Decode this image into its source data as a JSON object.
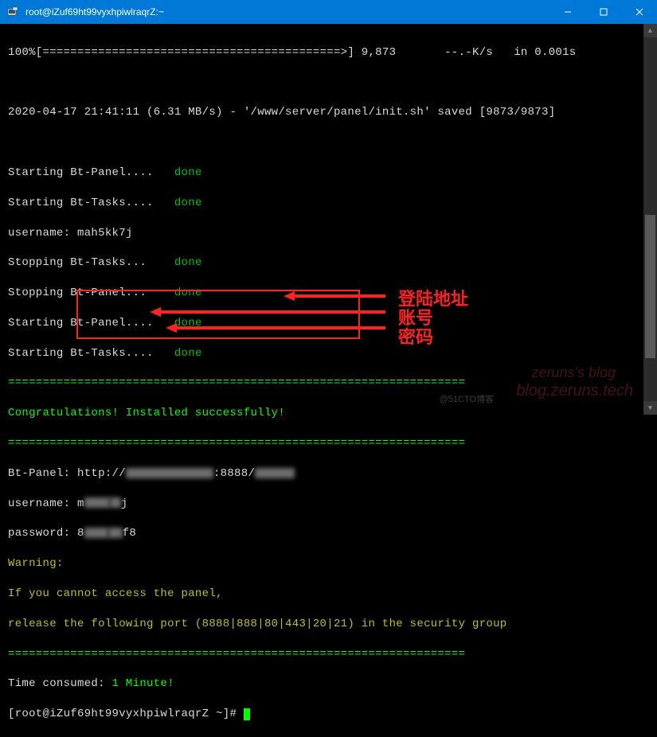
{
  "titlebar": {
    "title": "root@iZuf69ht99vyxhpiwlraqrZ:~"
  },
  "terminal": {
    "progress": "100%[===========================================>] 9,873       --.-K/s   in 0.001s",
    "saved": "2020-04-17 21:41:11 (6.31 MB/s) - '/www/server/panel/init.sh' saved [9873/9873]",
    "services": [
      {
        "label": "Starting Bt-Panel....   ",
        "status": "done"
      },
      {
        "label": "Starting Bt-Tasks....   ",
        "status": "done"
      }
    ],
    "username_line": "username: mah5kk7j",
    "services2": [
      {
        "label": "Stopping Bt-Tasks...    ",
        "status": "done"
      },
      {
        "label": "Stopping Bt-Panel...    ",
        "status": "done"
      },
      {
        "label": "Starting Bt-Panel....   ",
        "status": "done"
      },
      {
        "label": "Starting Bt-Tasks....   ",
        "status": "done"
      }
    ],
    "divider": "==================================================================",
    "congrats": "Congratulations! Installed successfully!",
    "panel_label": "Bt-Panel: ",
    "panel_url_prefix": "http://",
    "panel_url_port": ":8888/",
    "user_label": "username: m",
    "user_suffix": "j",
    "pass_label": "password: 8",
    "pass_suffix": "f8",
    "warning": "Warning:",
    "warn_line1": "If you cannot access the panel,",
    "warn_line2": "release the following port (8888|888|80|443|20|21) in the security group",
    "time_label": "Time consumed: ",
    "time_value": "1 Minute!",
    "prompt_host": "[root@iZuf69ht99vyxhpiwlraqrZ ~]# "
  },
  "annotations": {
    "login": "登陆地址",
    "account": "账号",
    "password": "密码"
  },
  "watermarks": {
    "w1": "zeruns's blog",
    "w2": "blog.zeruns.tech",
    "w3": "@51CTO博客"
  }
}
